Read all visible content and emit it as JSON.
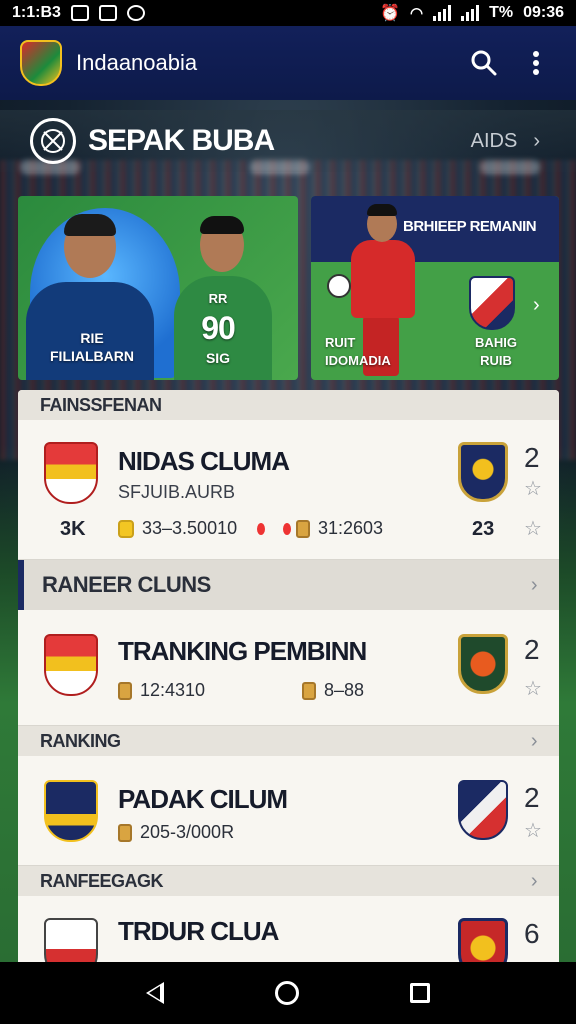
{
  "status_bar": {
    "time_left": "1:1:B3",
    "battery_text": "T%",
    "clock": "09:36"
  },
  "app_bar": {
    "title": "Indaanoabia",
    "icons": [
      "app-logo",
      "search-icon",
      "more-vert-icon"
    ]
  },
  "section": {
    "title": "SEPAK BUBA",
    "more_label": "AIDS"
  },
  "featured": {
    "left": {
      "player_label": "RIE\nFILIALBARN",
      "number_top": "RR",
      "number": "90",
      "number_bottom": "SIG"
    },
    "right": {
      "title": "BRHIEEP REMANIN",
      "label_left": "RUIT\nIDOMADIA",
      "label_right": "BAHIG\nRUIB"
    }
  },
  "list": {
    "group1": "FAINSSFENAN",
    "row1": {
      "name": "NIDAS CLUMA",
      "sub": "SFJUIB.AURB",
      "count": "3K",
      "stat1": "33–3.50010",
      "stat2": "31:2603",
      "opp_value": "23",
      "rank": "2"
    },
    "group2": "RANEER CLUNS",
    "row2": {
      "name": "TRANKING PEMBINN",
      "stat1": "12:4310",
      "stat2": "8–88",
      "rank": "2"
    },
    "group3": "RANKING",
    "row3": {
      "name": "PADAK CILUM",
      "stat1": "205-3/000R",
      "rank": "2"
    },
    "group4": "RANFEEGAGK",
    "row4": {
      "name": "TRDUR CLUA",
      "rank": "6"
    }
  },
  "colors": {
    "appbar": "#12205a",
    "accent_navy": "#1b2a63",
    "panel": "#f3f0ea",
    "pitch_green": "#43a047"
  }
}
